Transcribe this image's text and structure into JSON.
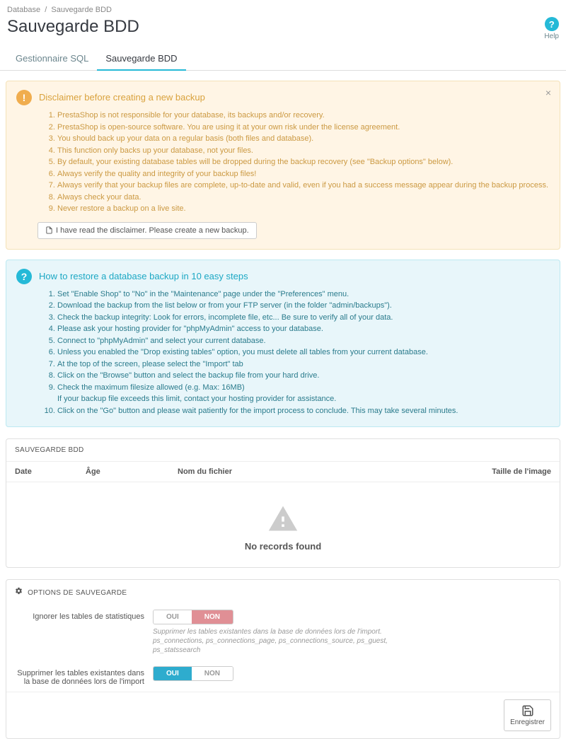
{
  "breadcrumb": {
    "root": "Database",
    "current": "Sauvegarde BDD"
  },
  "page_title": "Sauvegarde BDD",
  "help": {
    "label": "Help"
  },
  "tabs": [
    {
      "label": "Gestionnaire SQL",
      "active": false
    },
    {
      "label": "Sauvegarde BDD",
      "active": true
    }
  ],
  "disclaimer": {
    "title": "Disclaimer before creating a new backup",
    "items": [
      "PrestaShop is not responsible for your database, its backups and/or recovery.",
      "PrestaShop is open-source software. You are using it at your own risk under the license agreement.",
      "You should back up your data on a regular basis (both files and database).",
      "This function only backs up your database, not your files.",
      "By default, your existing database tables will be dropped during the backup recovery (see \"Backup options\" below).",
      "Always verify the quality and integrity of your backup files!",
      "Always verify that your backup files are complete, up-to-date and valid, even if you had a success message appear during the backup process.",
      "Always check your data.",
      "Never restore a backup on a live site."
    ],
    "button": "I have read the disclaimer. Please create a new backup."
  },
  "restore": {
    "title": "How to restore a database backup in 10 easy steps",
    "items": [
      "Set \"Enable Shop\" to \"No\" in the \"Maintenance\" page under the \"Preferences\" menu.",
      "Download the backup from the list below or from your FTP server (in the folder \"admin/backups\").",
      "Check the backup integrity: Look for errors, incomplete file, etc... Be sure to verify all of your data.",
      "Please ask your hosting provider for \"phpMyAdmin\" access to your database.",
      "Connect to \"phpMyAdmin\" and select your current database.",
      "Unless you enabled the \"Drop existing tables\" option, you must delete all tables from your current database.",
      "At the top of the screen, please select the \"Import\" tab",
      "Click on the \"Browse\" button and select the backup file from your hard drive.",
      "Check the maximum filesize allowed (e.g. Max: 16MB)",
      "Click on the \"Go\" button and please wait patiently for the import process to conclude. This may take several minutes."
    ],
    "item9_sub": "If your backup file exceeds this limit, contact your hosting provider for assistance."
  },
  "listing": {
    "heading": "SAUVEGARDE BDD",
    "columns": {
      "date": "Date",
      "age": "Âge",
      "file": "Nom du fichier",
      "size": "Taille de l'image"
    },
    "empty": "No records found"
  },
  "options": {
    "heading": "OPTIONS DE SAUVEGARDE",
    "toggle_on": "OUI",
    "toggle_off": "NON",
    "ignore_stats": {
      "label": "Ignorer les tables de statistiques",
      "value": false,
      "help1": "Supprimer les tables existantes dans la base de données lors de l'import.",
      "help2": "ps_connections, ps_connections_page, ps_connections_source, ps_guest, ps_statssearch"
    },
    "drop_tables": {
      "label": "Supprimer les tables existantes dans la base de données lors de l'import",
      "value": true
    },
    "save": "Enregistrer"
  }
}
